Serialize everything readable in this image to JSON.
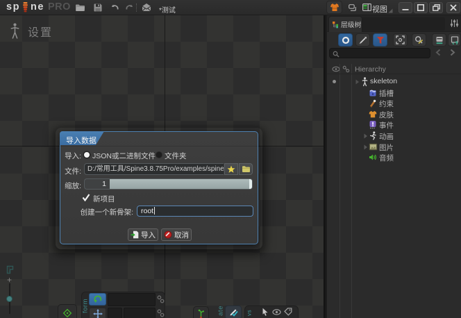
{
  "topbar": {
    "logo_sp": "sp",
    "logo_ne": "ne",
    "logo_badge": "PRO",
    "project_title": "*测试",
    "view_menu_label": "视图"
  },
  "canvas": {
    "mode_label": "设置",
    "zoom_in_glyph": "+"
  },
  "dialog": {
    "title": "导入数据",
    "import_label": "导入:",
    "radio_json_label": "JSON或二进制文件",
    "radio_json_selected": true,
    "radio_folder_label": "文件夹",
    "radio_folder_selected": false,
    "file_label": "文件:",
    "file_value": "D:/常用工具/Spine3.8.75Pro/examples/spine",
    "scale_label": "缩放:",
    "scale_value": "1",
    "new_project_label": "新项目",
    "new_project_checked": true,
    "new_skeleton_label": "创建一个新骨架:",
    "new_skeleton_value": "root",
    "import_button_label": "导入",
    "cancel_button_label": "取消"
  },
  "hierarchy_panel": {
    "tab_label": "层级树",
    "header_label": "Hierarchy",
    "search_value": "",
    "tree": [
      {
        "label": "skeleton",
        "icon": "skeleton-figure-icon"
      },
      {
        "label": "插槽",
        "icon": "slot-icon"
      },
      {
        "label": "约束",
        "icon": "constraint-icon"
      },
      {
        "label": "皮肤",
        "icon": "skin-icon"
      },
      {
        "label": "事件",
        "icon": "event-icon"
      },
      {
        "label": "动画",
        "icon": "animation-icon"
      },
      {
        "label": "图片",
        "icon": "images-icon"
      },
      {
        "label": "音频",
        "icon": "audio-icon"
      }
    ]
  },
  "bottom_toolbar": {
    "transform_label": "form",
    "create_label": "ate",
    "views_label": "vs"
  },
  "colors": {
    "dialog_border_blue": "#4e81b1",
    "dialog_tab_blue": "#3f74a8",
    "selected_tool_blue": "#2f6296",
    "slider_fill": "#a3b1b1",
    "accent_orange": "#e07820",
    "accent_green": "#3fae3f",
    "funnel_red": "#c53b2e"
  }
}
